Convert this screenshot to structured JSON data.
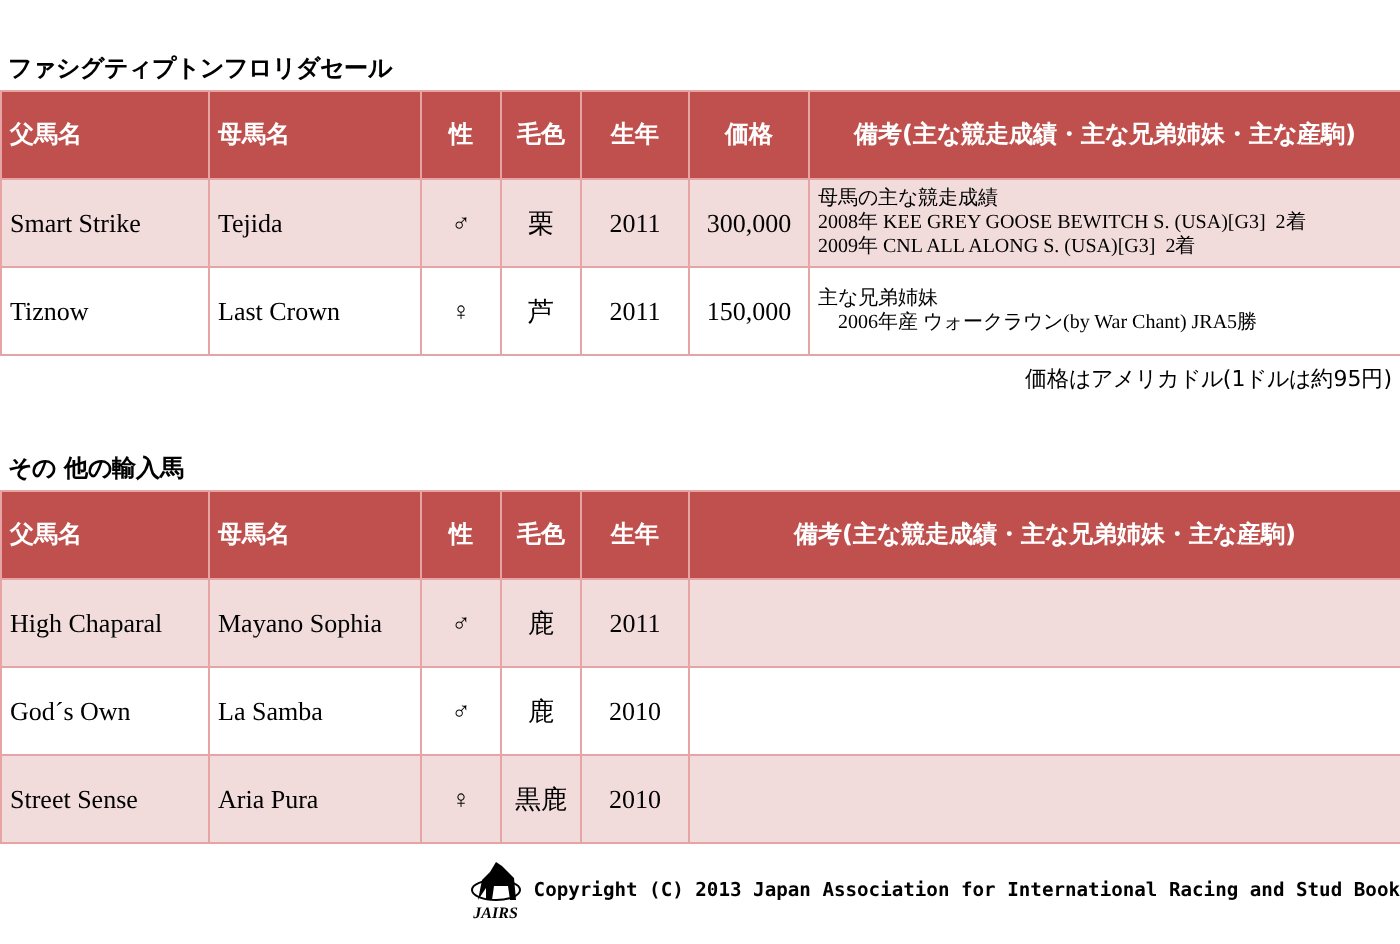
{
  "sections": [
    {
      "title": "ファシグティプトンフロリダセール",
      "columns": [
        "父馬名",
        "母馬名",
        "性",
        "毛色",
        "生年",
        "価格",
        "備考(主な競走成績・主な兄弟姉妹・主な産駒)"
      ],
      "rows": [
        {
          "sire": "Smart Strike",
          "dam": "Tejida",
          "sex": "♂",
          "coat": "栗",
          "year": "2011",
          "price": "300,000",
          "remarks": [
            "母馬の主な競走成績",
            "2008年 KEE GREY GOOSE BEWITCH S. (USA)[G3]  2着",
            "2009年 CNL ALL ALONG S. (USA)[G3]  2着"
          ]
        },
        {
          "sire": "Tiznow",
          "dam": "Last Crown",
          "sex": "♀",
          "coat": "芦",
          "year": "2011",
          "price": "150,000",
          "remarks": [
            "主な兄弟姉妹",
            "　2006年産 ウォークラウン(by War Chant) JRA5勝"
          ]
        }
      ],
      "note": "価格はアメリカドル(1ドルは約95円)"
    },
    {
      "title": "その 他の輸入馬",
      "columns": [
        "父馬名",
        "母馬名",
        "性",
        "毛色",
        "生年",
        "備考(主な競走成績・主な兄弟姉妹・主な産駒)"
      ],
      "rows": [
        {
          "sire": "High Chaparal",
          "dam": "Mayano Sophia",
          "sex": "♂",
          "coat": "鹿",
          "year": "2011",
          "remarks": []
        },
        {
          "sire": "God´s Own",
          "dam": "La Samba",
          "sex": "♂",
          "coat": "鹿",
          "year": "2010",
          "remarks": []
        },
        {
          "sire": "Street Sense",
          "dam": "Aria Pura",
          "sex": "♀",
          "coat": "黒鹿",
          "year": "2010",
          "remarks": []
        }
      ]
    }
  ],
  "footer": {
    "logo_text": "JAIRS",
    "copyright": "Copyright (C) 2013 Japan Association for International Racing and Stud Book"
  }
}
